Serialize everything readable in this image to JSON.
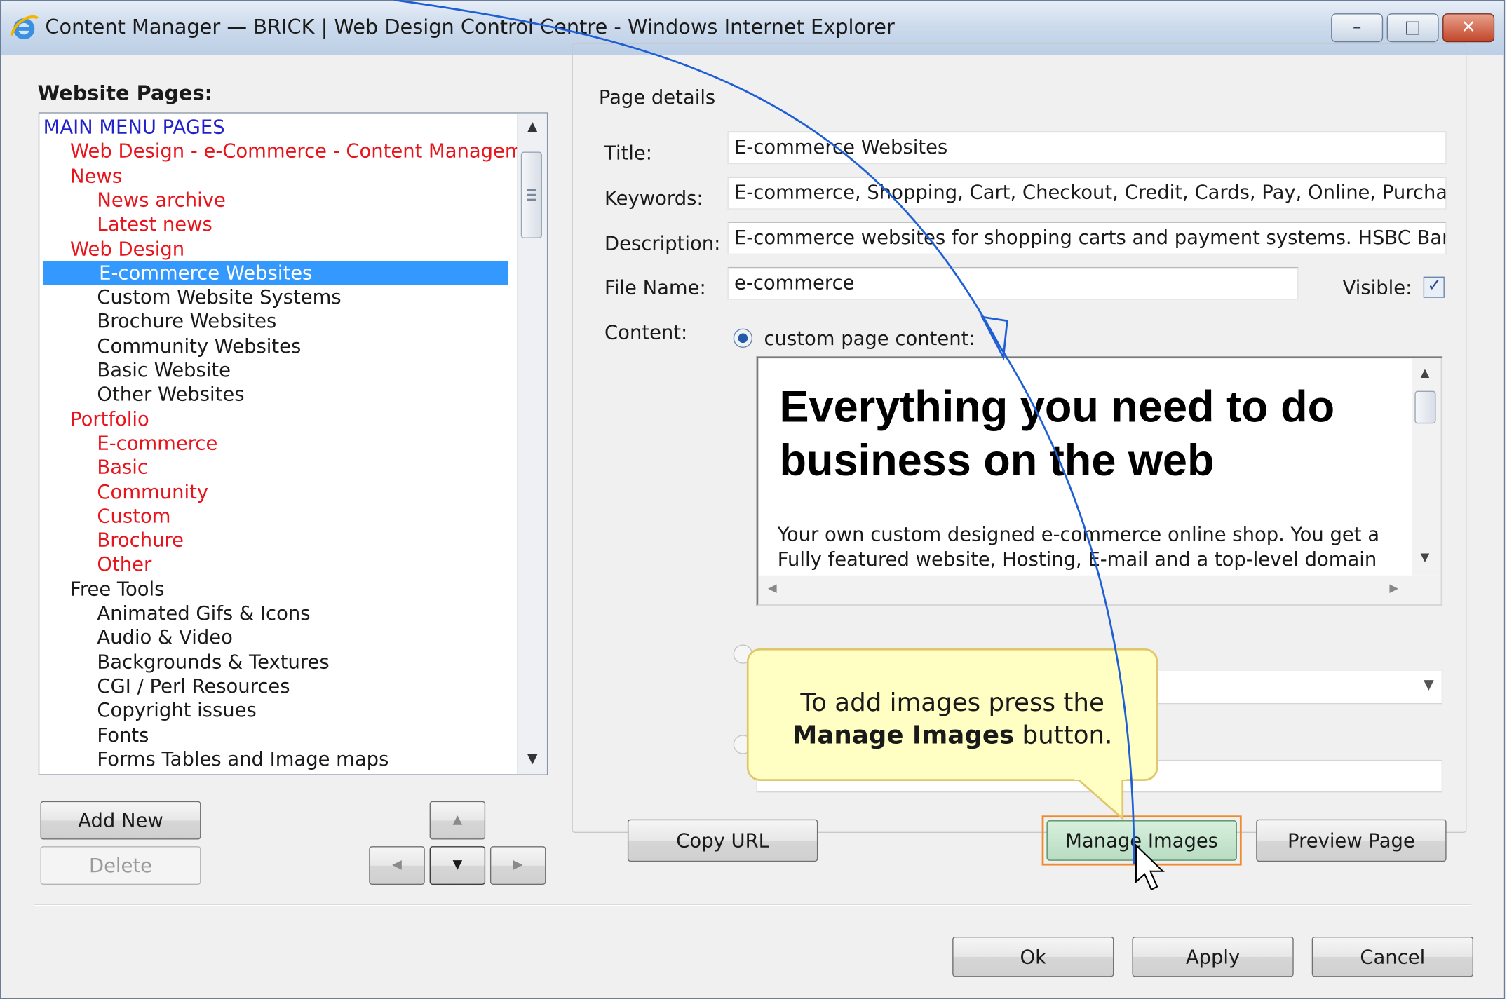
{
  "window": {
    "title": "Content Manager — BRICK | Web Design Control Centre - Windows Internet Explorer",
    "minimize_glyph": "–",
    "restore_glyph": "□",
    "close_glyph": "✕"
  },
  "left_panel": {
    "heading": "Website Pages:",
    "pages": [
      {
        "label": "MAIN MENU PAGES",
        "level": 0,
        "color": "#2222cc"
      },
      {
        "label": "Web Design - e-Commerce - Content Manageme",
        "level": 1,
        "color": "#e8141c"
      },
      {
        "label": "News",
        "level": 1,
        "color": "#e8141c"
      },
      {
        "label": "News archive",
        "level": 2,
        "color": "#e8141c"
      },
      {
        "label": "Latest news",
        "level": 2,
        "color": "#e8141c"
      },
      {
        "label": "Web Design",
        "level": 1,
        "color": "#e8141c"
      },
      {
        "label": "E-commerce Websites",
        "level": 2,
        "color": "#ffffff",
        "selected": true
      },
      {
        "label": "Custom Website Systems",
        "level": 2,
        "color": "#1a1a1a"
      },
      {
        "label": "Brochure Websites",
        "level": 2,
        "color": "#1a1a1a"
      },
      {
        "label": "Community Websites",
        "level": 2,
        "color": "#1a1a1a"
      },
      {
        "label": "Basic Website",
        "level": 2,
        "color": "#1a1a1a"
      },
      {
        "label": "Other Websites",
        "level": 2,
        "color": "#1a1a1a"
      },
      {
        "label": "Portfolio",
        "level": 1,
        "color": "#e8141c"
      },
      {
        "label": "E-commerce",
        "level": 2,
        "color": "#e8141c"
      },
      {
        "label": "Basic",
        "level": 2,
        "color": "#e8141c"
      },
      {
        "label": "Community",
        "level": 2,
        "color": "#e8141c"
      },
      {
        "label": "Custom",
        "level": 2,
        "color": "#e8141c"
      },
      {
        "label": "Brochure",
        "level": 2,
        "color": "#e8141c"
      },
      {
        "label": "Other",
        "level": 2,
        "color": "#e8141c"
      },
      {
        "label": "Free Tools",
        "level": 1,
        "color": "#1a1a1a"
      },
      {
        "label": "Animated Gifs & Icons",
        "level": 2,
        "color": "#1a1a1a"
      },
      {
        "label": "Audio & Video",
        "level": 2,
        "color": "#1a1a1a"
      },
      {
        "label": "Backgrounds & Textures",
        "level": 2,
        "color": "#1a1a1a"
      },
      {
        "label": "CGI / Perl Resources",
        "level": 2,
        "color": "#1a1a1a"
      },
      {
        "label": "Copyright issues",
        "level": 2,
        "color": "#1a1a1a"
      },
      {
        "label": "Fonts",
        "level": 2,
        "color": "#1a1a1a"
      },
      {
        "label": "Forms Tables and Image maps",
        "level": 2,
        "color": "#1a1a1a"
      }
    ],
    "add_new_label": "Add New",
    "delete_label": "Delete",
    "move_up_glyph": "▲",
    "move_left_glyph": "◀",
    "move_down_glyph": "▼",
    "move_right_glyph": "▶"
  },
  "page_details": {
    "legend": "Page details",
    "title_label": "Title:",
    "title_value": "E-commerce Websites",
    "keywords_label": "Keywords:",
    "keywords_value": "E-commerce, Shopping, Cart, Checkout, Credit, Cards, Pay, Online, Purchase,",
    "description_label": "Description:",
    "description_value": "E-commerce websites for shopping carts and payment systems. HSBC Barclayca",
    "filename_label": "File Name:",
    "filename_value": "e-commerce",
    "visible_label": "Visible:",
    "visible_checked": true,
    "content_label": "Content:",
    "custom_content_label": "custom page content:",
    "content_heading": "Everything you need to do business on the web",
    "content_body": "Your own custom designed e-commerce online shop. You get a Fully featured website, Hosting, E-mail and a top-level domain name",
    "copy_url_label": "Copy URL",
    "manage_images_label": "Manage Images",
    "preview_page_label": "Preview Page"
  },
  "callout": {
    "text_pre": "To add images press the",
    "text_bold": "Manage Images",
    "text_post": " button."
  },
  "footer": {
    "ok_label": "Ok",
    "apply_label": "Apply",
    "cancel_label": "Cancel"
  },
  "colors": {
    "selection": "#3399ff",
    "highlight_border": "#f08a2c",
    "callout_fill": "#ffffc4",
    "annotation_arrow": "#1f5fd6"
  }
}
